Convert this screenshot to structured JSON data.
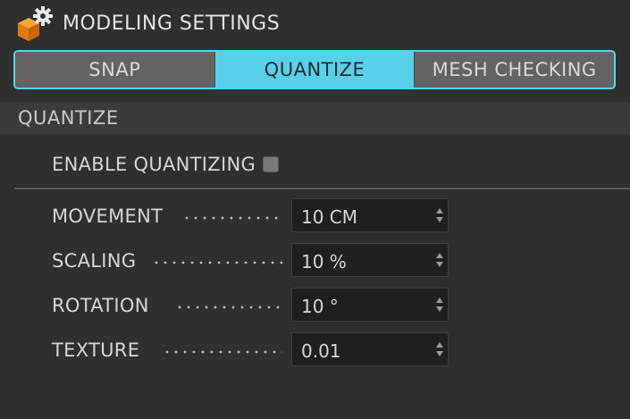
{
  "header": {
    "title": "MODELING SETTINGS",
    "icon": "cube-gear-icon"
  },
  "tabs": [
    {
      "label": "SNAP",
      "active": false
    },
    {
      "label": "QUANTIZE",
      "active": true
    },
    {
      "label": "MESH CHECKING",
      "active": false
    }
  ],
  "section": {
    "title": "QUANTIZE"
  },
  "enable": {
    "label": "ENABLE QUANTIZING",
    "checked": false
  },
  "params": [
    {
      "label": "MOVEMENT",
      "value": "10 CM"
    },
    {
      "label": "SCALING",
      "value": "10 %"
    },
    {
      "label": "ROTATION",
      "value": "10 °"
    },
    {
      "label": "TEXTURE",
      "value": "0.01"
    }
  ],
  "colors": {
    "accent": "#59d0ea",
    "background": "#2f2f2f",
    "field": "#1f1f1f",
    "icon_orange": "#f08a1e"
  }
}
